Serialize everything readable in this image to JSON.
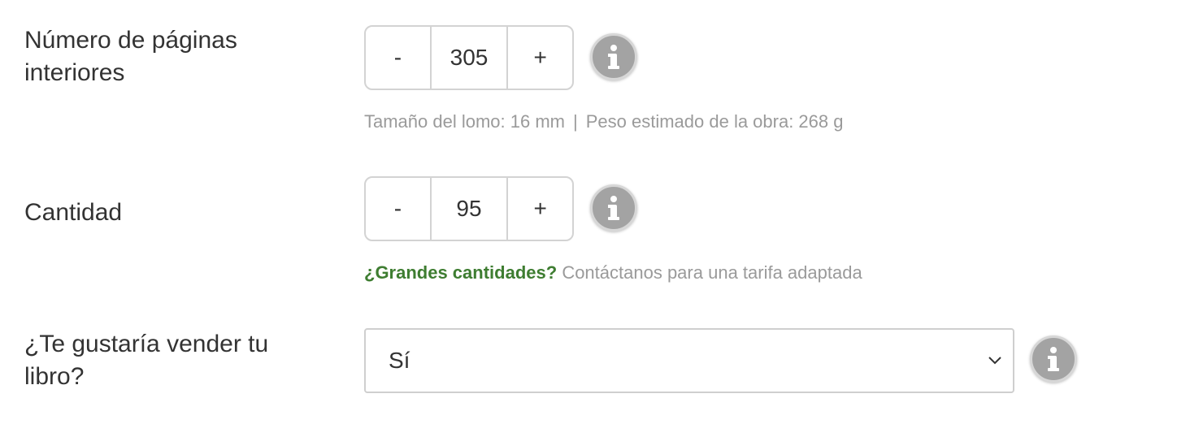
{
  "pages": {
    "label": "Número de páginas interiores",
    "minus": "-",
    "value": "305",
    "plus": "+",
    "spine_text": "Tamaño del lomo: 16 mm",
    "separator": "|",
    "weight_text": "Peso estimado de la obra: 268 g"
  },
  "quantity": {
    "label": "Cantidad",
    "minus": "-",
    "value": "95",
    "plus": "+",
    "bulk_link": "¿Grandes cantidades?",
    "bulk_text": "Contáctanos para una tarifa adaptada"
  },
  "sell": {
    "label": "¿Te gustaría vender tu libro?",
    "selected": "Sí"
  },
  "icons": {
    "info": "info-icon",
    "chevron": "chevron-down-icon"
  },
  "colors": {
    "accent_green": "#3e7d31",
    "info_grey": "#a3a3a3"
  }
}
